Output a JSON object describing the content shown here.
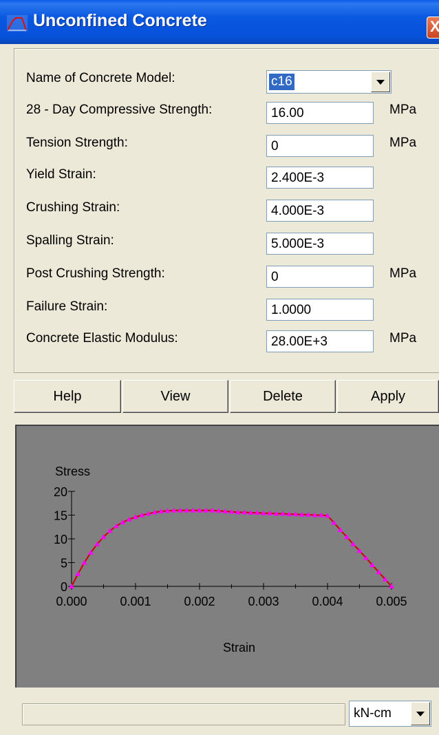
{
  "window": {
    "title": "Unconfined Concrete",
    "close_glyph": "X",
    "icon": "stress-strain-curve-icon"
  },
  "form": {
    "model": {
      "label": "Name of Concrete Model:",
      "value": "c16"
    },
    "fields": [
      {
        "label": "28 - Day Compressive Strength:",
        "value": "16.00",
        "unit": "MPa"
      },
      {
        "label": "Tension Strength:",
        "value": "0",
        "unit": "MPa"
      },
      {
        "label": "Yield Strain:",
        "value": "2.400E-3",
        "unit": ""
      },
      {
        "label": "Crushing Strain:",
        "value": "4.000E-3",
        "unit": ""
      },
      {
        "label": "Spalling Strain:",
        "value": "5.000E-3",
        "unit": ""
      },
      {
        "label": "Post Crushing Strength:",
        "value": "0",
        "unit": "MPa"
      },
      {
        "label": "Failure Strain:",
        "value": "1.0000",
        "unit": ""
      },
      {
        "label": "Concrete Elastic Modulus:",
        "value": "28.00E+3",
        "unit": "MPa"
      }
    ]
  },
  "buttons": {
    "help": "Help",
    "view": "View",
    "delete": "Delete",
    "apply": "Apply"
  },
  "chart_data": {
    "type": "line",
    "ylabel": "Stress",
    "xlabel": "Strain",
    "xlim": [
      0,
      0.005
    ],
    "ylim": [
      0,
      20
    ],
    "x_ticks": [
      "0.000",
      "0.001",
      "0.002",
      "0.003",
      "0.004",
      "0.005"
    ],
    "y_ticks": [
      "0",
      "5",
      "10",
      "15",
      "20"
    ],
    "grid": false,
    "background": "#808080",
    "colors": {
      "line": "#cc0000",
      "marker": "#ff00ff"
    },
    "series": [
      {
        "x": [
          0,
          0.0001,
          0.0002,
          0.0003,
          0.0004,
          0.0005,
          0.0006,
          0.0007,
          0.0008,
          0.0009,
          0.001,
          0.0011,
          0.0012,
          0.0013,
          0.0014,
          0.0015,
          0.0016,
          0.0017,
          0.0018,
          0.0019,
          0.002,
          0.0021,
          0.0022,
          0.0023,
          0.0024,
          0.0025,
          0.0026,
          0.0027,
          0.0028,
          0.0029,
          0.003,
          0.0031,
          0.0032,
          0.0033,
          0.0034,
          0.0035,
          0.0036,
          0.0037,
          0.0038,
          0.0039,
          0.004,
          0.0041,
          0.0042,
          0.0043,
          0.0044,
          0.0045,
          0.0046,
          0.0047,
          0.0048,
          0.0049,
          0.005
        ],
        "y": [
          0,
          2.6,
          5.0,
          7.1,
          8.9,
          10.4,
          11.7,
          12.7,
          13.5,
          14.1,
          14.6,
          15.0,
          15.3,
          15.6,
          15.8,
          15.9,
          16.0,
          16.0,
          16.0,
          16.0,
          16.0,
          16.0,
          16.0,
          15.9,
          15.8,
          15.7,
          15.6,
          15.6,
          15.5,
          15.5,
          15.4,
          15.4,
          15.3,
          15.3,
          15.2,
          15.2,
          15.1,
          15.1,
          15.0,
          15.0,
          14.9,
          13.4,
          11.9,
          10.4,
          8.9,
          7.5,
          6.0,
          4.5,
          3.0,
          1.5,
          0
        ]
      }
    ]
  },
  "status": {
    "text": "",
    "units": "kN-cm"
  }
}
